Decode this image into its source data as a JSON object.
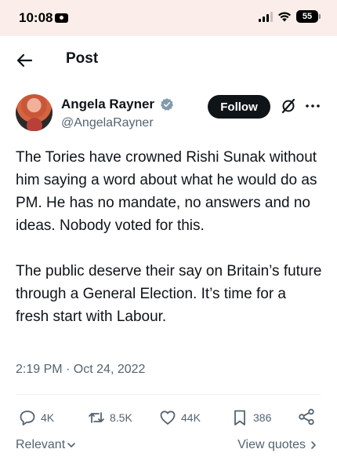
{
  "status_bar": {
    "time": "10:08",
    "battery": "55"
  },
  "header": {
    "title": "Post"
  },
  "author": {
    "name": "Angela Rayner",
    "handle": "@AngelaRayner"
  },
  "follow_label": "Follow",
  "tweet": {
    "paragraphs": [
      "The Tories have crowned Rishi Sunak without him saying a word about what he would do as PM. He has no mandate, no answers and no ideas. Nobody voted for this.",
      "The public deserve their say on Britain’s future through a General Election. It’s time for a fresh start with Labour."
    ],
    "timestamp": "2:19 PM · Oct 24, 2022"
  },
  "actions": {
    "replies": "4K",
    "reposts": "8.5K",
    "likes": "44K",
    "bookmarks": "386"
  },
  "footer": {
    "sort_label": "Relevant",
    "quotes_label": "View quotes"
  },
  "colors": {
    "text": "#0f1419",
    "secondary": "#536471",
    "verified": "#829aab",
    "status_bg": "#fbeeea"
  }
}
